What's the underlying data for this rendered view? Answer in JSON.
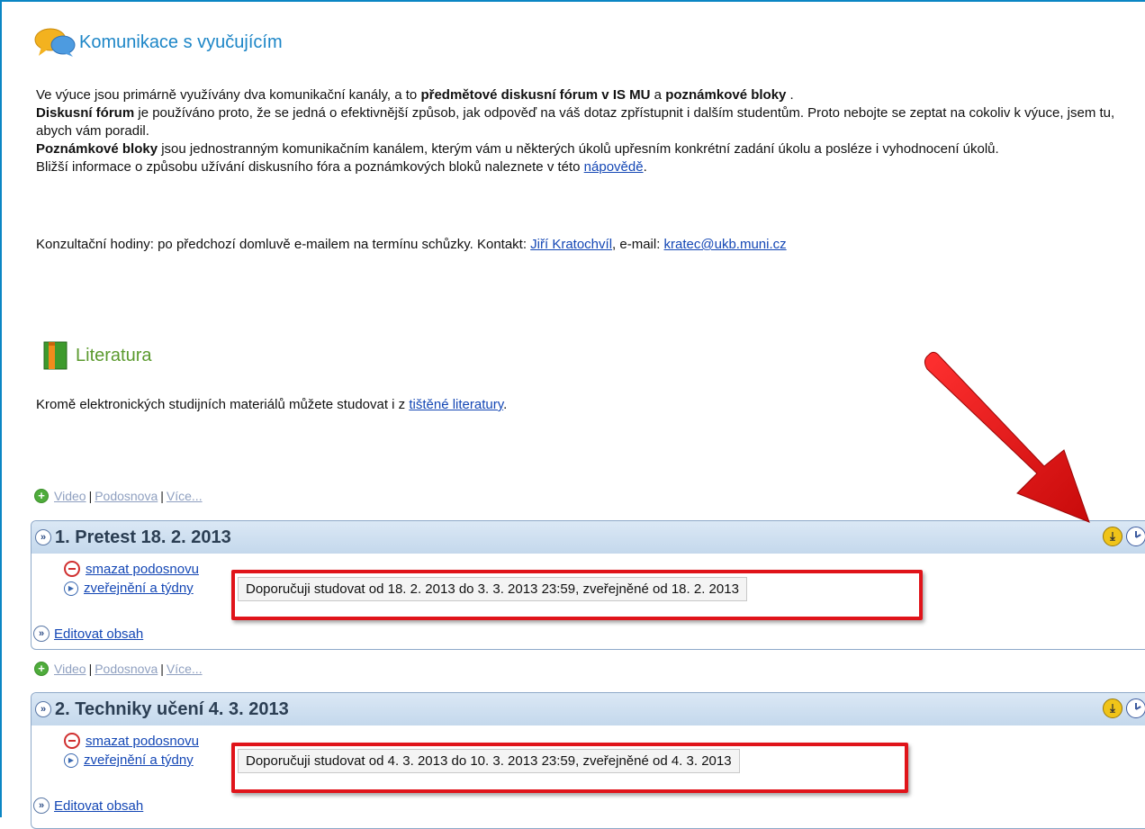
{
  "komunikace": {
    "title": "Komunikace s vyučujícím",
    "p1_a": "Ve výuce jsou primárně využívány dva komunikační kanály, a to ",
    "p1_b": "předmětové diskusní fórum v IS MU",
    "p1_c": " a ",
    "p1_d": "poznámkové bloky",
    "p1_e": " .",
    "p2_a": "Diskusní fórum",
    "p2_b": " je používáno proto, že se jedná o efektivnější způsob, jak odpověď na váš dotaz zpřístupnit i dalším studentům. Proto nebojte se zeptat na cokoliv k výuce, jsem tu, abych vám poradil.",
    "p3_a": "Poznámkové bloky",
    "p3_b": " jsou jednostranným komunikačním kanálem, kterým vám u některých úkolů upřesním konkrétní zadání úkolu a posléze i vyhodnocení úkolů.",
    "p4_a": "Bližší informace o způsobu užívání diskusního fóra a poznámkových bloků naleznete v této ",
    "p4_link": "nápovědě",
    "p4_end": ".",
    "consult_a": "Konzultační hodiny: po předchozí domluvě e-mailem na termínu schůzky. Kontakt: ",
    "consult_link_name": "Jiří Kratochvíl",
    "consult_b": ", e-mail: ",
    "consult_link_email": "kratec@ukb.muni.cz"
  },
  "literatura": {
    "title": "Literatura",
    "text_a": "Kromě elektronických studijních materiálů můžete studovat i z ",
    "text_link": "tištěné literatury",
    "text_end": "."
  },
  "addline": {
    "video": "Video",
    "podosnova": "Podosnova",
    "vice": "Více...",
    "sep": "|"
  },
  "blocks": [
    {
      "title": "1. Pretest 18. 2. 2013",
      "delete": "smazat podosnovu",
      "publish": "zveřejnění a týdny",
      "tooltip": "Doporučuji studovat od 18. 2. 2013 do 3. 3. 2013 23:59, zveřejněné od 18. 2. 2013",
      "edit": "Editovat obsah"
    },
    {
      "title": "2. Techniky učení 4. 3. 2013",
      "delete": "smazat podosnovu",
      "publish": "zveřejnění a týdny",
      "tooltip": "Doporučuji studovat od 4. 3. 2013 do 10. 3. 2013 23:59, zveřejněné od 4. 3. 2013",
      "edit": "Editovat obsah"
    }
  ],
  "colors": {
    "accent_blue": "#1d86c7",
    "literatura_green": "#5b9a2e",
    "highlight_red": "#e0141a",
    "link": "#1447b5"
  }
}
